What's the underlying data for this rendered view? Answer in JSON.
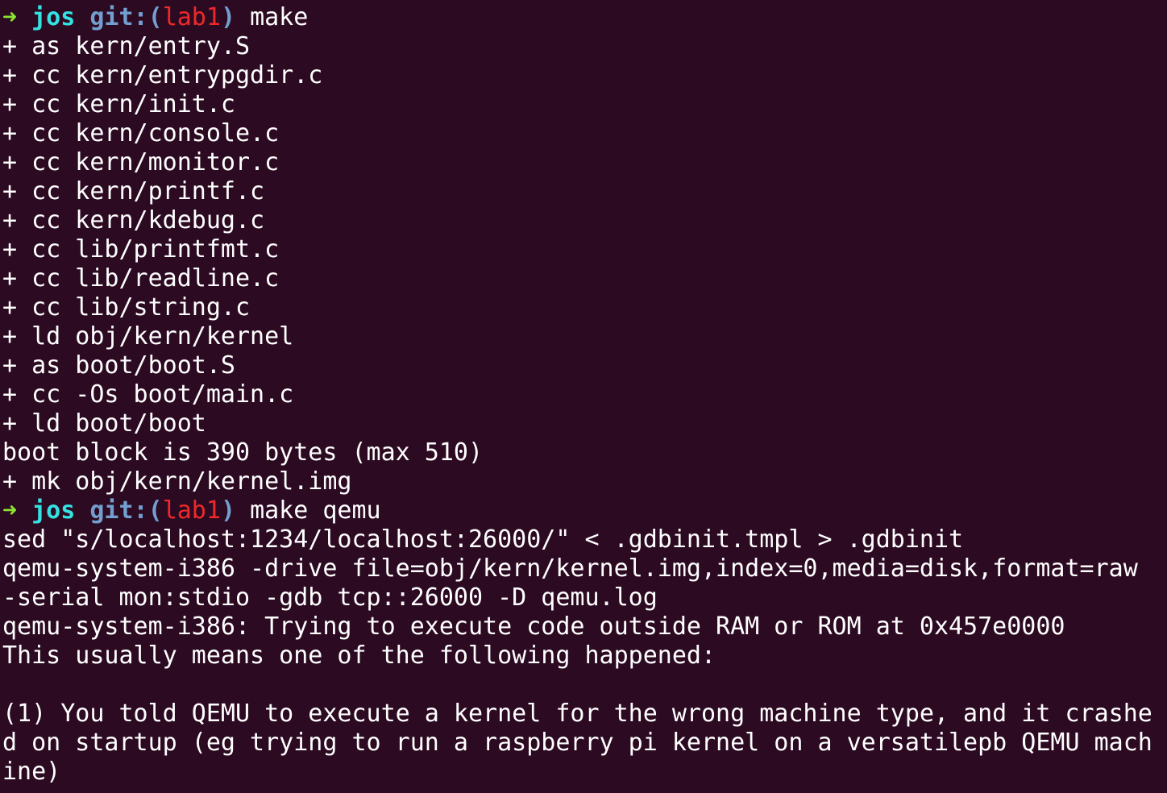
{
  "colors": {
    "background": "#2c0a22",
    "text": "#ffffff",
    "prompt_arrow": "#8ae234",
    "prompt_dir": "#34e2e2",
    "prompt_git": "#729fcf",
    "prompt_branch": "#ef2929"
  },
  "top_partial_line": "",
  "prompts": [
    {
      "arrow": "➜",
      "dir": "jos",
      "git_label": "git:(",
      "branch": "lab1",
      "git_close": ")",
      "command": "make"
    },
    {
      "arrow": "➜",
      "dir": "jos",
      "git_label": "git:(",
      "branch": "lab1",
      "git_close": ")",
      "command": "make qemu"
    }
  ],
  "make_output": [
    "+ as kern/entry.S",
    "+ cc kern/entrypgdir.c",
    "+ cc kern/init.c",
    "+ cc kern/console.c",
    "+ cc kern/monitor.c",
    "+ cc kern/printf.c",
    "+ cc kern/kdebug.c",
    "+ cc lib/printfmt.c",
    "+ cc lib/readline.c",
    "+ cc lib/string.c",
    "+ ld obj/kern/kernel",
    "+ as boot/boot.S",
    "+ cc -Os boot/main.c",
    "+ ld boot/boot",
    "boot block is 390 bytes (max 510)",
    "+ mk obj/kern/kernel.img"
  ],
  "qemu_output": [
    "sed \"s/localhost:1234/localhost:26000/\" < .gdbinit.tmpl > .gdbinit",
    "qemu-system-i386 -drive file=obj/kern/kernel.img,index=0,media=disk,format=raw",
    "-serial mon:stdio -gdb tcp::26000 -D qemu.log",
    "qemu-system-i386: Trying to execute code outside RAM or ROM at 0x457e0000",
    "This usually means one of the following happened:",
    "",
    "(1) You told QEMU to execute a kernel for the wrong machine type, and it crashe",
    "d on startup (eg trying to run a raspberry pi kernel on a versatilepb QEMU mach",
    "ine)"
  ]
}
